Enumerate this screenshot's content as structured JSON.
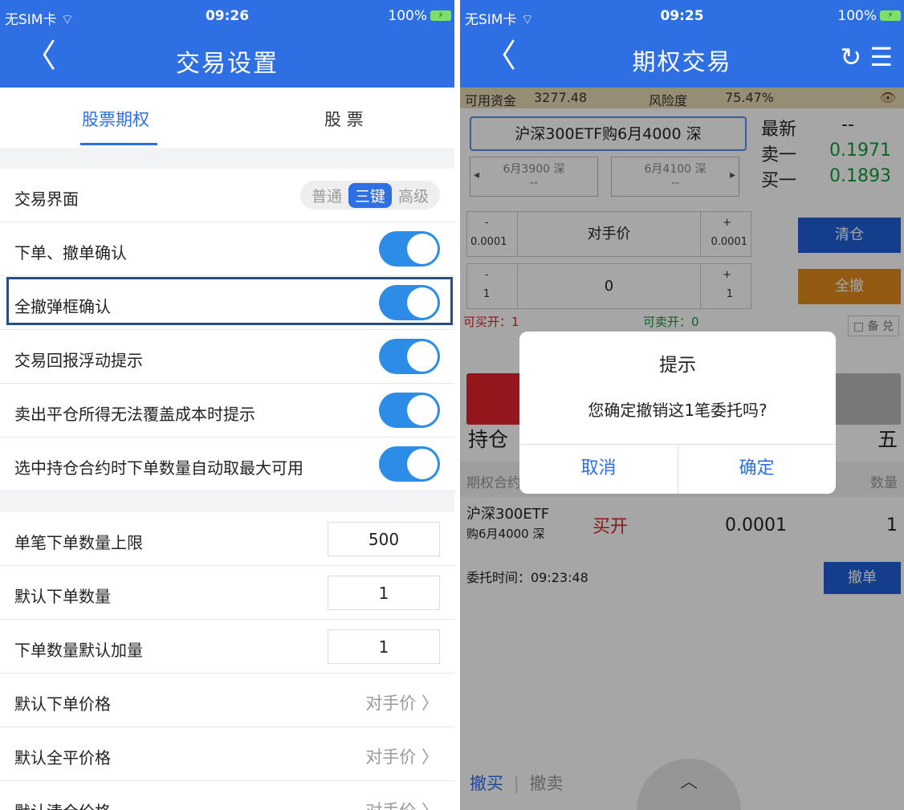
{
  "left": {
    "status": {
      "carrier": "无SIM卡 ⌔",
      "time": "09:26",
      "battery_text": "100%"
    },
    "nav": {
      "back": "〈",
      "title": "交易设置"
    },
    "tabs": [
      {
        "label": "股票期权",
        "active": true
      },
      {
        "label": "股 票",
        "active": false
      }
    ],
    "settings": {
      "trade_ui": {
        "label": "交易界面",
        "options": [
          "普通",
          "三键",
          "高级"
        ],
        "selected": "三键"
      },
      "toggles": [
        {
          "label": "下单、撤单确认",
          "on": true
        },
        {
          "label": "全撤弹框确认",
          "on": true
        },
        {
          "label": "交易回报浮动提示",
          "on": true
        },
        {
          "label": "卖出平仓所得无法覆盖成本时提示",
          "on": true
        },
        {
          "label": "选中持仓合约时下单数量自动取最大可用",
          "on": true
        }
      ],
      "numbers": [
        {
          "label": "单笔下单数量上限",
          "value": "500"
        },
        {
          "label": "默认下单数量",
          "value": "1"
        },
        {
          "label": "下单数量默认加量",
          "value": "1"
        }
      ],
      "choices": [
        {
          "label": "默认下单价格",
          "value": "对手价 〉"
        },
        {
          "label": "默认全平价格",
          "value": "对手价 〉"
        },
        {
          "label": "默认清仓价格",
          "value": "对手价 〉"
        }
      ]
    }
  },
  "right": {
    "status": {
      "carrier": "无SIM卡 ⌔",
      "time": "09:25",
      "battery_text": "100%"
    },
    "nav": {
      "back": "〈",
      "title": "期权交易",
      "refresh_icon": "refresh-icon",
      "menu_icon": "menu-icon"
    },
    "fund": {
      "label": "可用资金",
      "amount": "3277.48",
      "risk_label": "风险度",
      "risk": "75.47%"
    },
    "contract": "沪深300ETF购6月4000 深",
    "prev_contract": {
      "name": "6月3900 深",
      "sub": "--"
    },
    "next_contract": {
      "name": "6月4100 深",
      "sub": "--"
    },
    "quotes": {
      "latest_label": "最新",
      "latest": "--",
      "ask_label": "卖一",
      "ask": "0.1971",
      "bid_label": "买一",
      "bid": "0.1893"
    },
    "price_stepper": {
      "minus": "-",
      "minus_step": "0.0001",
      "value": "对手价",
      "plus": "+",
      "plus_step": "0.0001"
    },
    "qty_stepper": {
      "minus": "-",
      "minus_step": "1",
      "value": "0",
      "plus": "+",
      "plus_step": "1"
    },
    "buttons": {
      "clear": "清仓",
      "cancel_all": "全撤"
    },
    "can_buy": "可买开：1",
    "can_sell": "可卖开：0",
    "covered": "□ 备 兑",
    "positions_title": "持仓",
    "right_tab": "五",
    "header": {
      "col1": "期权合约",
      "col_last": "数量"
    },
    "order": {
      "name": "沪深300ETF",
      "sub": "购6月4000 深",
      "side": "买开",
      "price": "0.0001",
      "qty": "1",
      "time": "委托时间：09:23:48",
      "cancel": "撤单"
    },
    "bottom_tabs": {
      "buy": "撤买",
      "sell": "撤卖"
    },
    "dialog": {
      "title": "提示",
      "message": "您确定撤销这1笔委托吗?",
      "cancel": "取消",
      "confirm": "确定"
    }
  },
  "colors": {
    "brand": "#2f6fe4",
    "toggle": "#2d8de6",
    "red": "#e0232b",
    "green": "#119a39",
    "orange": "#e08a1e"
  }
}
